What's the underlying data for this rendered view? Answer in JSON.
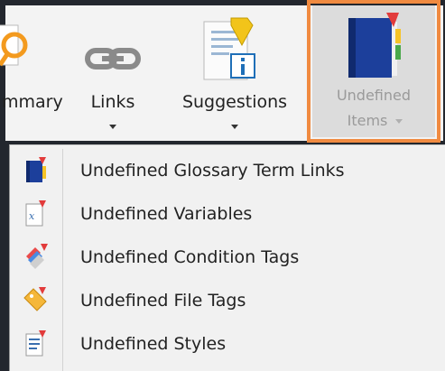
{
  "ribbon": {
    "summary_label": "mmary",
    "links_label": "Links",
    "suggestions_label": "Suggestions",
    "undefined_label_line1": "Undefined",
    "undefined_label_line2": "Items"
  },
  "menu": {
    "items": [
      {
        "label": "Undefined Glossary Term Links",
        "icon": "glossary-book-icon"
      },
      {
        "label": "Undefined Variables",
        "icon": "variable-icon"
      },
      {
        "label": "Undefined Condition Tags",
        "icon": "condition-tags-icon"
      },
      {
        "label": "Undefined File Tags",
        "icon": "file-tag-icon"
      },
      {
        "label": "Undefined Styles",
        "icon": "styles-icon"
      }
    ]
  },
  "colors": {
    "highlight_border": "#f08a40",
    "background": "#23272e",
    "ribbon": "#f3f3f3",
    "menu": "#f1f1f1"
  }
}
